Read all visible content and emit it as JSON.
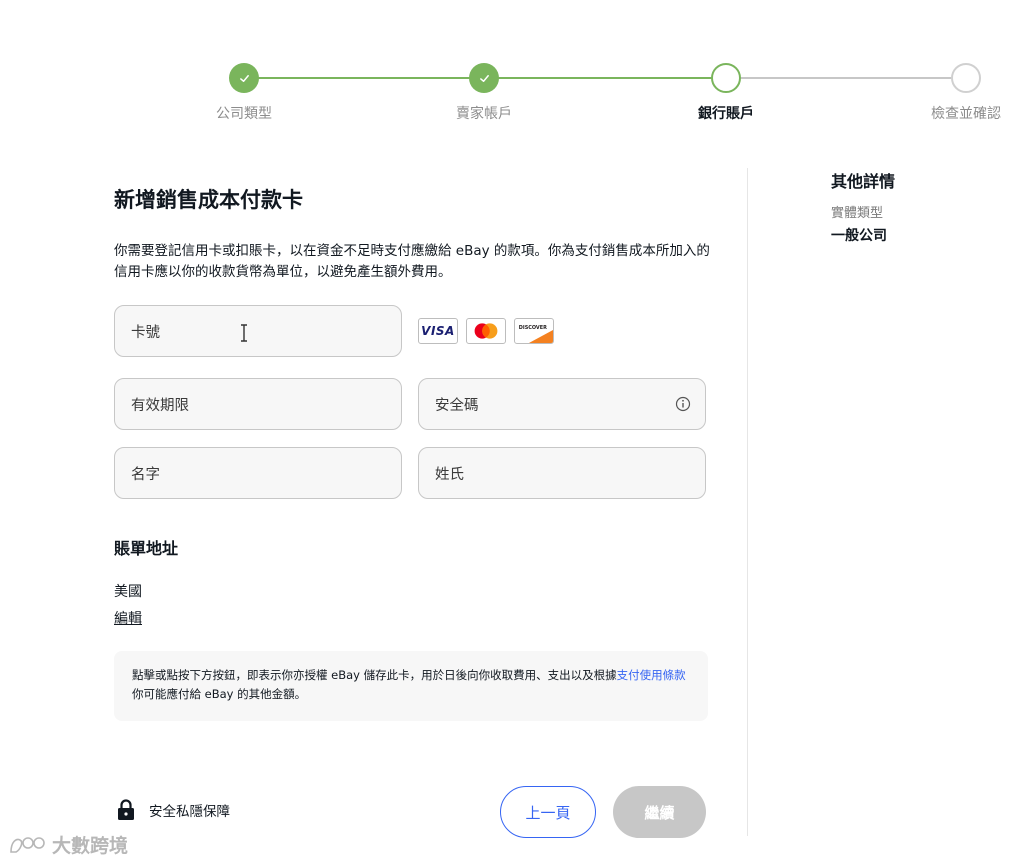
{
  "stepper": {
    "steps": [
      {
        "label": "公司類型",
        "state": "done"
      },
      {
        "label": "賣家帳戶",
        "state": "done"
      },
      {
        "label": "銀行賬戶",
        "state": "current"
      },
      {
        "label": "檢查並確認",
        "state": "todo"
      }
    ],
    "accent_color": "#7ab55c"
  },
  "sidebar": {
    "title": "其他詳情",
    "entity_type_label": "實體類型",
    "entity_type_value": "一般公司"
  },
  "form": {
    "title": "新增銷售成本付款卡",
    "description": "你需要登記信用卡或扣賬卡，以在資金不足時支付應繳給 eBay 的款項。你為支付銷售成本所加入的信用卡應以你的收款貨幣為單位，以避免產生額外費用。",
    "fields": {
      "card_number": "卡號",
      "expiry": "有效期限",
      "security_code": "安全碼",
      "first_name": "名字",
      "last_name": "姓氏"
    },
    "card_brands": [
      "VISA",
      "Mastercard",
      "DISCOVER"
    ]
  },
  "billing": {
    "title": "賬單地址",
    "country": "美國",
    "edit_label": "編輯"
  },
  "notice": {
    "text_before": "點擊或點按下方按鈕，即表示你亦授權 eBay 儲存此卡，用於日後向你收取費用、支出以及根據",
    "link_text": "支付使用條款",
    "text_after": "你可能應付給 eBay 的其他金額。",
    "link_color": "#3665f3"
  },
  "footer": {
    "privacy_label": "安全私隱保障",
    "prev_label": "上一頁",
    "next_label": "繼續",
    "watermark_text": "大數跨境"
  }
}
